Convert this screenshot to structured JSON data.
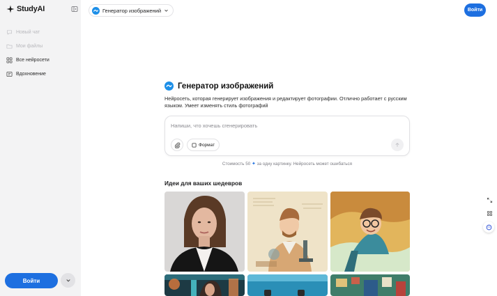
{
  "app": {
    "name": "StudyAI"
  },
  "sidebar": {
    "items": [
      {
        "label": "Новый чат",
        "icon": "chat-icon",
        "muted": true
      },
      {
        "label": "Мои файлы",
        "icon": "folder-icon",
        "muted": true
      },
      {
        "label": "Все нейросети",
        "icon": "grid-icon",
        "muted": false
      },
      {
        "label": "Вдохновение",
        "icon": "inspiration-icon",
        "muted": false
      }
    ],
    "login_label": "Войти"
  },
  "header": {
    "model_label": "Генератор изображений",
    "login_label": "Войти"
  },
  "main": {
    "title": "Генератор изображений",
    "description": "Нейросеть, которая генерирует изображения и редактирует фотографии. Отлично работает с русским языком. Умеет изменять стиль фотографий",
    "prompt_placeholder": "Напиши, что хочешь сгенерировать",
    "format_label": "Формат",
    "cost_prefix": "Стоимость 50",
    "cost_suffix": "за одну картинку. Нейросеть может ошибаться",
    "ideas_title": "Идеи для ваших шедевров"
  },
  "colors": {
    "accent": "#1d6fe0",
    "sidebar_bg": "#f3f3f4"
  },
  "right_tools": [
    "expand-icon",
    "apps-icon",
    "assistant-icon"
  ]
}
